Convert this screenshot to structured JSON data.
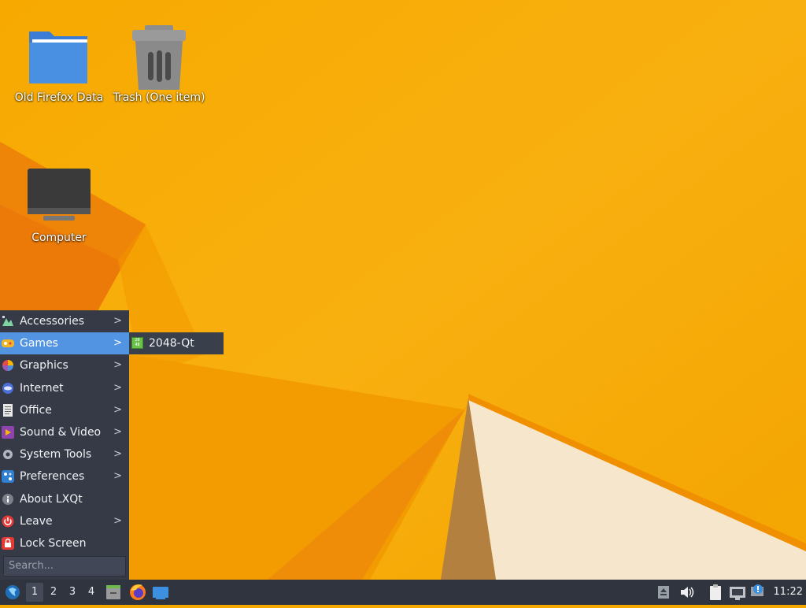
{
  "desktop": {
    "icons": [
      {
        "label": "Old Firefox Data",
        "icon": "folder-icon"
      },
      {
        "label": "Trash (One item)",
        "icon": "trash-icon"
      },
      {
        "label": "Computer",
        "icon": "computer-icon"
      }
    ]
  },
  "start_menu": {
    "items": [
      {
        "label": "Accessories",
        "icon": "accessories-icon",
        "has_submenu": true
      },
      {
        "label": "Games",
        "icon": "games-icon",
        "has_submenu": true,
        "active": true
      },
      {
        "label": "Graphics",
        "icon": "graphics-icon",
        "has_submenu": true
      },
      {
        "label": "Internet",
        "icon": "internet-icon",
        "has_submenu": true
      },
      {
        "label": "Office",
        "icon": "office-icon",
        "has_submenu": true
      },
      {
        "label": "Sound & Video",
        "icon": "sound-video-icon",
        "has_submenu": true
      },
      {
        "label": "System Tools",
        "icon": "system-tools-icon",
        "has_submenu": true
      },
      {
        "label": "Preferences",
        "icon": "preferences-icon",
        "has_submenu": true
      },
      {
        "label": "About LXQt",
        "icon": "info-icon",
        "has_submenu": false
      },
      {
        "label": "Leave",
        "icon": "power-icon",
        "has_submenu": true
      },
      {
        "label": "Lock Screen",
        "icon": "lock-icon",
        "has_submenu": false
      }
    ],
    "search_placeholder": "Search..."
  },
  "games_submenu": {
    "items": [
      {
        "label": "2048-Qt",
        "icon": "2048-qt-icon"
      }
    ]
  },
  "taskbar": {
    "workspaces": [
      "1",
      "2",
      "3",
      "4"
    ],
    "active_workspace": "1",
    "launchers": [
      "file-manager-icon",
      "firefox-icon",
      "show-desktop-icon"
    ],
    "tray": [
      "removable-media-icon",
      "volume-icon",
      "clipboard-icon",
      "network-icon",
      "update-notifier-icon"
    ],
    "clock": "11:22"
  },
  "colors": {
    "wallpaper": "#f5a800",
    "menu_bg": "#353a46",
    "menu_highlight": "#5294e2",
    "taskbar_bg": "#2f343f"
  }
}
